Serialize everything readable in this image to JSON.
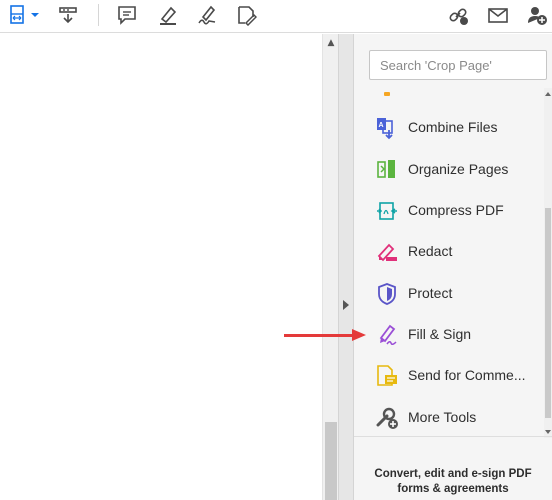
{
  "toolbar": {
    "left_icons": [
      "page-fit-icon",
      "dropdown-caret-icon",
      "save-down-icon"
    ],
    "markup_icons": [
      "comment-icon",
      "highlight-pen-icon",
      "sign-pen-icon",
      "edit-stamp-icon"
    ],
    "right_icons": [
      "share-link-icon",
      "email-icon",
      "add-user-icon"
    ]
  },
  "tools_pane": {
    "search_placeholder": "Search 'Crop Page'",
    "items": [
      {
        "label": "Combine Files",
        "icon": "combine-files-icon",
        "color": "#4b62d8"
      },
      {
        "label": "Organize Pages",
        "icon": "organize-pages-icon",
        "color": "#5bb43f"
      },
      {
        "label": "Compress PDF",
        "icon": "compress-pdf-icon",
        "color": "#0fa3a6"
      },
      {
        "label": "Redact",
        "icon": "redact-icon",
        "color": "#e0307a"
      },
      {
        "label": "Protect",
        "icon": "protect-shield-icon",
        "color": "#5a55c8"
      },
      {
        "label": "Fill & Sign",
        "icon": "fill-sign-icon",
        "color": "#9a4fd6"
      },
      {
        "label": "Send for Comme...",
        "icon": "send-for-comments-icon",
        "color": "#e7b90f"
      },
      {
        "label": "More Tools",
        "icon": "more-tools-icon",
        "color": "#555555"
      }
    ],
    "promo_line1": "Convert, edit and e-sign PDF",
    "promo_line2": "forms & agreements"
  },
  "colors": {
    "annotation_arrow": "#e43a3a",
    "toolbar_icon": "#4a4a4a",
    "accent_blue": "#1473e6"
  }
}
